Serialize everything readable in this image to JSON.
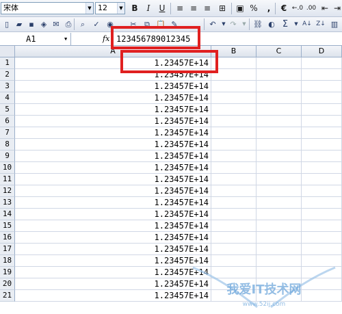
{
  "toolbar1": {
    "font_name": "宋体",
    "font_size": "12",
    "bold": "B",
    "italic": "I",
    "underline": "U",
    "percent": "%",
    "comma": ",",
    "euro": "€"
  },
  "toolbar2": {
    "sum": "Σ"
  },
  "formula_bar": {
    "name_box": "A1",
    "fx": "fx",
    "value": "123456789012345"
  },
  "columns": [
    "A",
    "B",
    "C",
    "D"
  ],
  "rows": [
    {
      "num": "1",
      "a": "1.23457E+14"
    },
    {
      "num": "2",
      "a": "1.23457E+14"
    },
    {
      "num": "3",
      "a": "1.23457E+14"
    },
    {
      "num": "4",
      "a": "1.23457E+14"
    },
    {
      "num": "5",
      "a": "1.23457E+14"
    },
    {
      "num": "6",
      "a": "1.23457E+14"
    },
    {
      "num": "7",
      "a": "1.23457E+14"
    },
    {
      "num": "8",
      "a": "1.23457E+14"
    },
    {
      "num": "9",
      "a": "1.23457E+14"
    },
    {
      "num": "10",
      "a": "1.23457E+14"
    },
    {
      "num": "11",
      "a": "1.23457E+14"
    },
    {
      "num": "12",
      "a": "1.23457E+14"
    },
    {
      "num": "13",
      "a": "1.23457E+14"
    },
    {
      "num": "14",
      "a": "1.23457E+14"
    },
    {
      "num": "15",
      "a": "1.23457E+14"
    },
    {
      "num": "16",
      "a": "1.23457E+14"
    },
    {
      "num": "17",
      "a": "1.23457E+14"
    },
    {
      "num": "18",
      "a": "1.23457E+14"
    },
    {
      "num": "19",
      "a": "1.23457E+14"
    },
    {
      "num": "20",
      "a": "1.23457E+14"
    },
    {
      "num": "21",
      "a": "1.23457E+14"
    }
  ],
  "watermark": {
    "text": "我爱IT技术网",
    "url": "www.52ij.com"
  }
}
